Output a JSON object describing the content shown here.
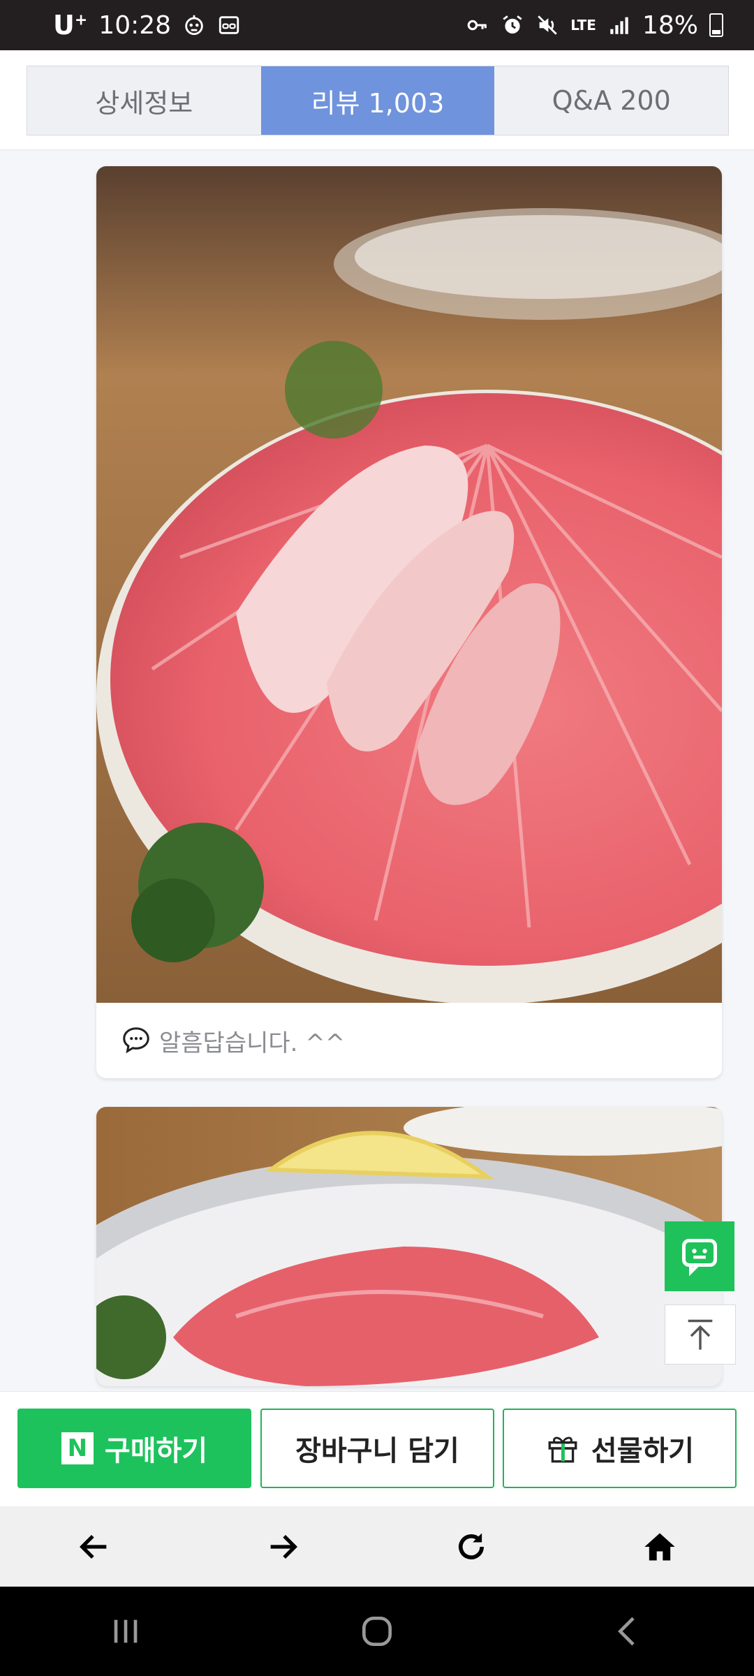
{
  "status_bar": {
    "carrier": "U",
    "carrier_sup": "+",
    "time": "10:28",
    "network": "LTE",
    "battery": "18%"
  },
  "tabs": [
    {
      "label": "상세정보",
      "active": false
    },
    {
      "label": "리뷰  1,003",
      "active": true
    },
    {
      "label": "Q&A  200",
      "active": false
    }
  ],
  "reviews": [
    {
      "image": "sliced-tuna-platter-photo",
      "comment": "알흠답습니다. ^^"
    },
    {
      "image": "tuna-sushi-lemon-photo"
    }
  ],
  "actions": {
    "buy_label": "구매하기",
    "cart_label": "장바구니 담기",
    "gift_label": "선물하기",
    "n_logo": "N"
  },
  "colors": {
    "active_tab": "#6f93dc",
    "brand_green": "#1ec25c",
    "status_bar": "#231f20"
  }
}
